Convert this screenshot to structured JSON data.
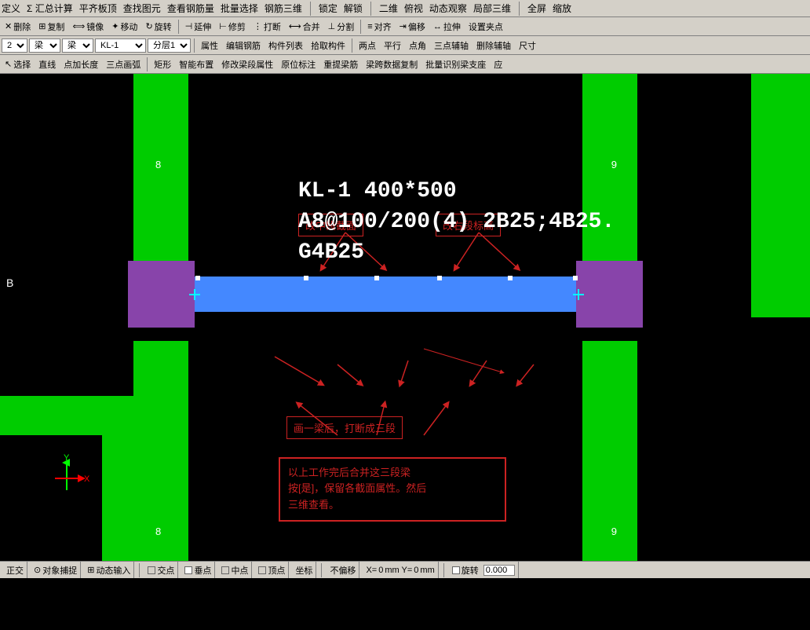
{
  "menubar": {
    "items": [
      "定义",
      "Σ 汇总计算",
      "平齐板顶",
      "查找图元",
      "查看钢筋量",
      "批量选择",
      "钢筋三维",
      "锁定",
      "解锁",
      "二维",
      "俯视",
      "动态观察",
      "局部三维",
      "全屏",
      "缩放"
    ]
  },
  "toolbar1": {
    "buttons": [
      "删除",
      "复制",
      "镜像",
      "移动",
      "旋转",
      "延伸",
      "修剪",
      "打断",
      "合并",
      "分割",
      "对齐",
      "偏移",
      "拉伸",
      "设置夹点"
    ]
  },
  "toolbar2": {
    "select1": "2",
    "select2": "梁",
    "select3": "梁",
    "select4": "KL-1",
    "select5": "分层1",
    "buttons": [
      "属性",
      "编辑钢筋",
      "构件列表",
      "拾取构件",
      "两点",
      "平行",
      "点角",
      "三点辅轴",
      "删除辅轴",
      "尺寸"
    ]
  },
  "toolbar3": {
    "buttons": [
      "选择",
      "直线",
      "点加长度",
      "三点画弧",
      "矩形",
      "智能布置",
      "修改梁段属性",
      "原位标注",
      "重提梁筋",
      "梁跨数据复制",
      "批量识别梁支座",
      "应"
    ]
  },
  "canvas": {
    "beam_annotation1": "改中段截面",
    "beam_annotation2": "改右段标高",
    "beam_text_line1": "KL-1 400*500",
    "beam_text_line2": "A8@100/200(4) 2B25;4B25.",
    "beam_text_line3": "G4B25",
    "break_label": "画一梁后，打断成三段",
    "info_text_line1": "以上工作完后合并这三段梁",
    "info_text_line2": "按[是]，保留各截面属性。然后",
    "info_text_line3": "三维查看。",
    "b_label": "B",
    "num8_left": "8",
    "num9_right": "9",
    "num8_bottom_left": "8",
    "num9_bottom_right": "9"
  },
  "statusbar": {
    "items": [
      "正交",
      "对象捕捉",
      "动态输入",
      "交点",
      "垂点",
      "中点",
      "顶点",
      "坐标",
      "不偏移",
      "X=",
      "0",
      "mm Y=",
      "0",
      "mm",
      "旋转",
      "0.000"
    ]
  }
}
